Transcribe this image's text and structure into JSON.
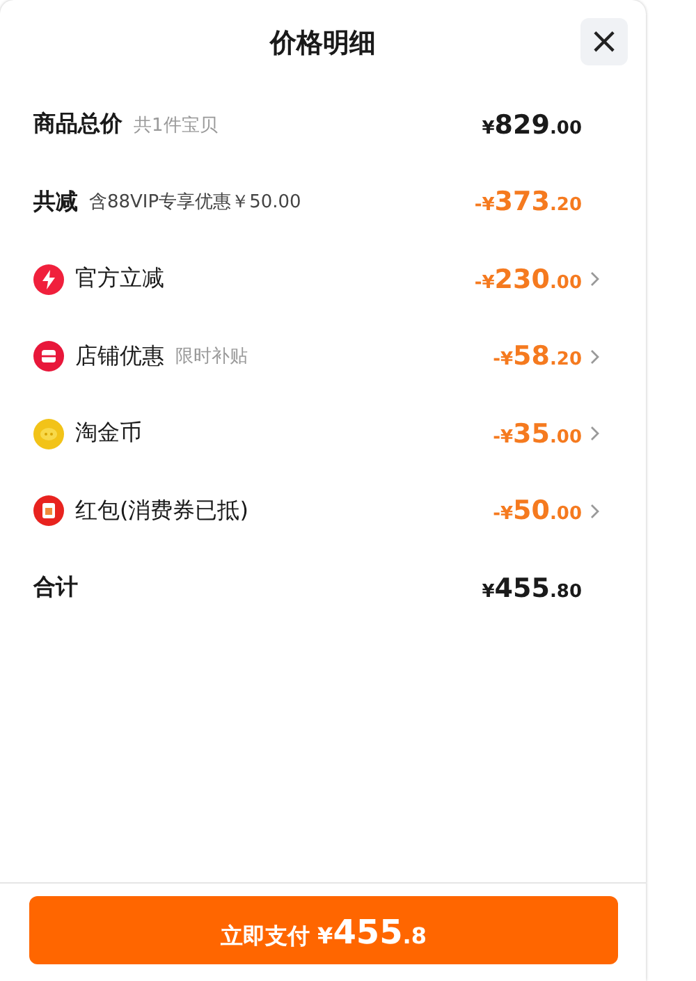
{
  "title": "价格明细",
  "close": "×",
  "rows": [
    {
      "kind": "total",
      "label": "商品总价",
      "note": "共1件宝贝",
      "prefix": "¥",
      "main": "829",
      "cents": ".00"
    },
    {
      "kind": "discount",
      "label": "共减",
      "note": "含88VIP专享优惠￥50.00",
      "prefix": "-¥",
      "main": "373",
      "cents": ".20"
    },
    {
      "kind": "item",
      "label": "官方立减",
      "prefix": "-¥",
      "main": "230",
      "cents": ".00"
    },
    {
      "kind": "item",
      "label": "店铺优惠",
      "note": "限时补贴",
      "prefix": "-¥",
      "main": "58",
      "cents": ".20"
    },
    {
      "kind": "item",
      "label": "淘金币",
      "prefix": "-¥",
      "main": "35",
      "cents": ".00"
    },
    {
      "kind": "item",
      "label": "红包(消费券已抵)",
      "prefix": "-¥",
      "main": "50",
      "cents": ".00"
    },
    {
      "kind": "total",
      "label": "合计",
      "prefix": "¥",
      "main": "455",
      "cents": ".80"
    }
  ],
  "pay_button": {
    "label": "立即支付",
    "prefix": "¥",
    "main": "455",
    "cents": ".8"
  }
}
